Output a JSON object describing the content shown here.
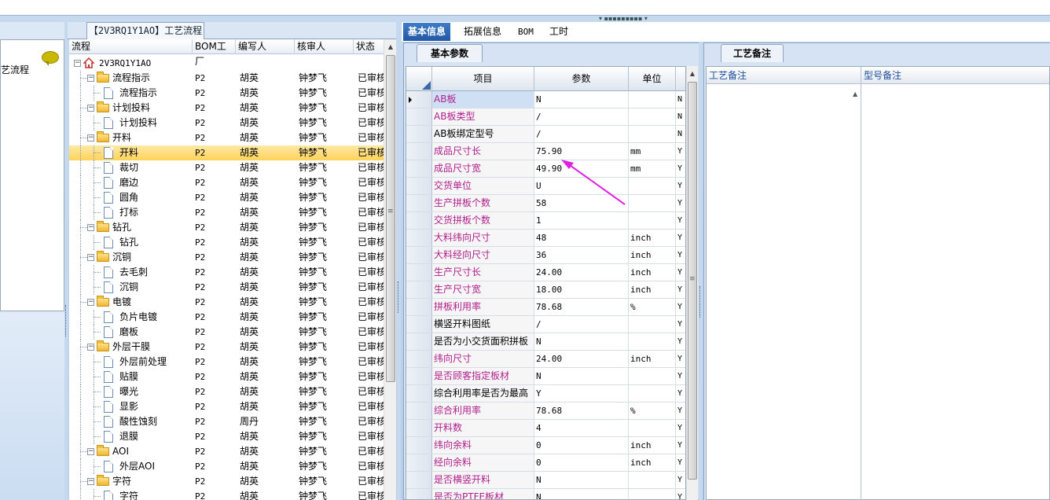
{
  "left_pane": {
    "item_label": "艺流程"
  },
  "tree": {
    "tab_title": "【2V3RQ1Y1AO】工艺流程",
    "columns": [
      "流程",
      "BOM工厂",
      "编写人",
      "核审人",
      "状态"
    ],
    "rows": [
      {
        "label": "2V3RQ1Y1AO",
        "kind": "root",
        "level": 0,
        "bom": "",
        "writer": "",
        "reviewer": "",
        "status": ""
      },
      {
        "label": "流程指示",
        "kind": "folder",
        "level": 1,
        "bom": "P2",
        "writer": "胡英",
        "reviewer": "钟梦飞",
        "status": "已审核"
      },
      {
        "label": "流程指示",
        "kind": "doc",
        "level": 2,
        "bom": "P2",
        "writer": "胡英",
        "reviewer": "钟梦飞",
        "status": "已审核"
      },
      {
        "label": "计划投料",
        "kind": "folder",
        "level": 1,
        "bom": "P2",
        "writer": "胡英",
        "reviewer": "钟梦飞",
        "status": "已审核"
      },
      {
        "label": "计划投料",
        "kind": "doc",
        "level": 2,
        "bom": "P2",
        "writer": "胡英",
        "reviewer": "钟梦飞",
        "status": "已审核"
      },
      {
        "label": "开料",
        "kind": "folder",
        "level": 1,
        "bom": "P2",
        "writer": "胡英",
        "reviewer": "钟梦飞",
        "status": "已审核"
      },
      {
        "label": "开料",
        "kind": "doc",
        "level": 2,
        "bom": "P2",
        "writer": "胡英",
        "reviewer": "钟梦飞",
        "status": "已审核",
        "selected": true
      },
      {
        "label": "裁切",
        "kind": "doc",
        "level": 2,
        "bom": "P2",
        "writer": "胡英",
        "reviewer": "钟梦飞",
        "status": "已审核"
      },
      {
        "label": "磨边",
        "kind": "doc",
        "level": 2,
        "bom": "P2",
        "writer": "胡英",
        "reviewer": "钟梦飞",
        "status": "已审核"
      },
      {
        "label": "圆角",
        "kind": "doc",
        "level": 2,
        "bom": "P2",
        "writer": "胡英",
        "reviewer": "钟梦飞",
        "status": "已审核"
      },
      {
        "label": "打标",
        "kind": "doc",
        "level": 2,
        "bom": "P2",
        "writer": "胡英",
        "reviewer": "钟梦飞",
        "status": "已审核"
      },
      {
        "label": "钻孔",
        "kind": "folder",
        "level": 1,
        "bom": "P2",
        "writer": "胡英",
        "reviewer": "钟梦飞",
        "status": "已审核"
      },
      {
        "label": "钻孔",
        "kind": "doc",
        "level": 2,
        "bom": "P2",
        "writer": "胡英",
        "reviewer": "钟梦飞",
        "status": "已审核"
      },
      {
        "label": "沉铜",
        "kind": "folder",
        "level": 1,
        "bom": "P2",
        "writer": "胡英",
        "reviewer": "钟梦飞",
        "status": "已审核"
      },
      {
        "label": "去毛刺",
        "kind": "doc",
        "level": 2,
        "bom": "P2",
        "writer": "胡英",
        "reviewer": "钟梦飞",
        "status": "已审核"
      },
      {
        "label": "沉铜",
        "kind": "doc",
        "level": 2,
        "bom": "P2",
        "writer": "胡英",
        "reviewer": "钟梦飞",
        "status": "已审核"
      },
      {
        "label": "电镀",
        "kind": "folder",
        "level": 1,
        "bom": "P2",
        "writer": "胡英",
        "reviewer": "钟梦飞",
        "status": "已审核"
      },
      {
        "label": "负片电镀",
        "kind": "doc",
        "level": 2,
        "bom": "P2",
        "writer": "胡英",
        "reviewer": "钟梦飞",
        "status": "已审核"
      },
      {
        "label": "磨板",
        "kind": "doc",
        "level": 2,
        "bom": "P2",
        "writer": "胡英",
        "reviewer": "钟梦飞",
        "status": "已审核"
      },
      {
        "label": "外层干膜",
        "kind": "folder",
        "level": 1,
        "bom": "P2",
        "writer": "胡英",
        "reviewer": "钟梦飞",
        "status": "已审核"
      },
      {
        "label": "外层前处理",
        "kind": "doc",
        "level": 2,
        "bom": "P2",
        "writer": "胡英",
        "reviewer": "钟梦飞",
        "status": "已审核"
      },
      {
        "label": "贴膜",
        "kind": "doc",
        "level": 2,
        "bom": "P2",
        "writer": "胡英",
        "reviewer": "钟梦飞",
        "status": "已审核"
      },
      {
        "label": "曝光",
        "kind": "doc",
        "level": 2,
        "bom": "P2",
        "writer": "胡英",
        "reviewer": "钟梦飞",
        "status": "已审核"
      },
      {
        "label": "显影",
        "kind": "doc",
        "level": 2,
        "bom": "P2",
        "writer": "胡英",
        "reviewer": "钟梦飞",
        "status": "已审核"
      },
      {
        "label": "酸性蚀刻",
        "kind": "doc",
        "level": 2,
        "bom": "P2",
        "writer": "周丹",
        "reviewer": "钟梦飞",
        "status": "已审核"
      },
      {
        "label": "退膜",
        "kind": "doc",
        "level": 2,
        "bom": "P2",
        "writer": "胡英",
        "reviewer": "钟梦飞",
        "status": "已审核"
      },
      {
        "label": "AOI",
        "kind": "folder",
        "level": 1,
        "bom": "P2",
        "writer": "胡英",
        "reviewer": "钟梦飞",
        "status": "已审核"
      },
      {
        "label": "外层AOI",
        "kind": "doc",
        "level": 2,
        "bom": "P2",
        "writer": "胡英",
        "reviewer": "钟梦飞",
        "status": "已审核"
      },
      {
        "label": "字符",
        "kind": "folder",
        "level": 1,
        "bom": "P2",
        "writer": "胡英",
        "reviewer": "钟梦飞",
        "status": "已审核"
      },
      {
        "label": "字符",
        "kind": "doc",
        "level": 2,
        "bom": "P2",
        "writer": "胡英",
        "reviewer": "钟梦飞",
        "status": "已审核"
      }
    ]
  },
  "right_tabs": [
    "基本信息",
    "拓展信息",
    "BOM",
    "工时"
  ],
  "params": {
    "tab_title": "基本参数",
    "columns": [
      "项目",
      "参数",
      "单位"
    ],
    "rows": [
      {
        "name": "AB板",
        "value": "N",
        "unit": "",
        "flag": "N",
        "color": "magenta",
        "current": true,
        "highlight": true
      },
      {
        "name": "AB板类型",
        "value": "/",
        "unit": "",
        "flag": "N",
        "color": "magenta"
      },
      {
        "name": "AB板绑定型号",
        "value": "/",
        "unit": "",
        "flag": "N",
        "color": "black"
      },
      {
        "name": "成品尺寸长",
        "value": "75.90",
        "unit": "mm",
        "flag": "Y",
        "color": "magenta"
      },
      {
        "name": "成品尺寸宽",
        "value": "49.90",
        "unit": "mm",
        "flag": "Y",
        "color": "magenta"
      },
      {
        "name": "交货单位",
        "value": "U",
        "unit": "",
        "flag": "Y",
        "color": "magenta"
      },
      {
        "name": "生产拼板个数",
        "value": "58",
        "unit": "",
        "flag": "Y",
        "color": "magenta"
      },
      {
        "name": "交货拼板个数",
        "value": "1",
        "unit": "",
        "flag": "Y",
        "color": "magenta"
      },
      {
        "name": "大料纬向尺寸",
        "value": "48",
        "unit": "inch",
        "flag": "Y",
        "color": "magenta"
      },
      {
        "name": "大料经向尺寸",
        "value": "36",
        "unit": "inch",
        "flag": "Y",
        "color": "magenta"
      },
      {
        "name": "生产尺寸长",
        "value": "24.00",
        "unit": "inch",
        "flag": "Y",
        "color": "magenta"
      },
      {
        "name": "生产尺寸宽",
        "value": "18.00",
        "unit": "inch",
        "flag": "Y",
        "color": "magenta"
      },
      {
        "name": "拼板利用率",
        "value": "78.68",
        "unit": "%",
        "flag": "Y",
        "color": "magenta"
      },
      {
        "name": "横竖开料图纸",
        "value": "/",
        "unit": "",
        "flag": "Y",
        "color": "black"
      },
      {
        "name": "是否为小交货面积拼板",
        "value": "N",
        "unit": "",
        "flag": "Y",
        "color": "black"
      },
      {
        "name": "纬向尺寸",
        "value": "24.00",
        "unit": "inch",
        "flag": "Y",
        "color": "magenta"
      },
      {
        "name": "是否顾客指定板材",
        "value": "N",
        "unit": "",
        "flag": "Y",
        "color": "magenta"
      },
      {
        "name": "综合利用率是否为最高",
        "value": "Y",
        "unit": "",
        "flag": "Y",
        "color": "black"
      },
      {
        "name": "综合利用率",
        "value": "78.68",
        "unit": "%",
        "flag": "Y",
        "color": "magenta"
      },
      {
        "name": "开料数",
        "value": "4",
        "unit": "",
        "flag": "Y",
        "color": "magenta"
      },
      {
        "name": "纬向余料",
        "value": "0",
        "unit": "inch",
        "flag": "Y",
        "color": "magenta"
      },
      {
        "name": "经向余料",
        "value": "0",
        "unit": "inch",
        "flag": "Y",
        "color": "magenta"
      },
      {
        "name": "是否横竖开料",
        "value": "N",
        "unit": "",
        "flag": "Y",
        "color": "magenta"
      },
      {
        "name": "是否为PTFE板材",
        "value": "N",
        "unit": "",
        "flag": "Y",
        "color": "magenta"
      }
    ]
  },
  "remarks": {
    "tab_title": "工艺备注",
    "columns": [
      "工艺备注",
      "型号备注"
    ]
  },
  "colors": {
    "accent": "#2358a3",
    "magenta": "#b0208e",
    "selection": "#ffd35a",
    "annotation_arrow": "#e020e0"
  }
}
